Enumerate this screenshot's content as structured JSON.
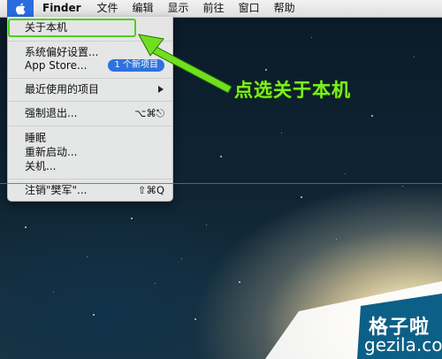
{
  "menubar": {
    "app_name": "Finder",
    "items": [
      "文件",
      "编辑",
      "显示",
      "前往",
      "窗口",
      "帮助"
    ]
  },
  "apple_menu": {
    "about": "关于本机",
    "system_prefs": "系统偏好设置...",
    "app_store": "App Store...",
    "app_store_badge": "1 个新项目",
    "recent_items": "最近使用的项目",
    "force_quit": "强制退出...",
    "force_quit_shortcut": "⌥⌘⎋",
    "sleep": "睡眠",
    "restart": "重新启动...",
    "shutdown": "关机...",
    "logout": "注销\"樊军\"...",
    "logout_shortcut": "⇧⌘Q"
  },
  "annotation": {
    "text": "点选关于本机",
    "color": "#7cf21e"
  },
  "watermark": {
    "chinese": "格子啦",
    "domain": "gezila.com"
  },
  "colors": {
    "highlight_border": "#49d21c",
    "badge": "#2e72de",
    "apple_menu_active": "#2b6be0"
  }
}
